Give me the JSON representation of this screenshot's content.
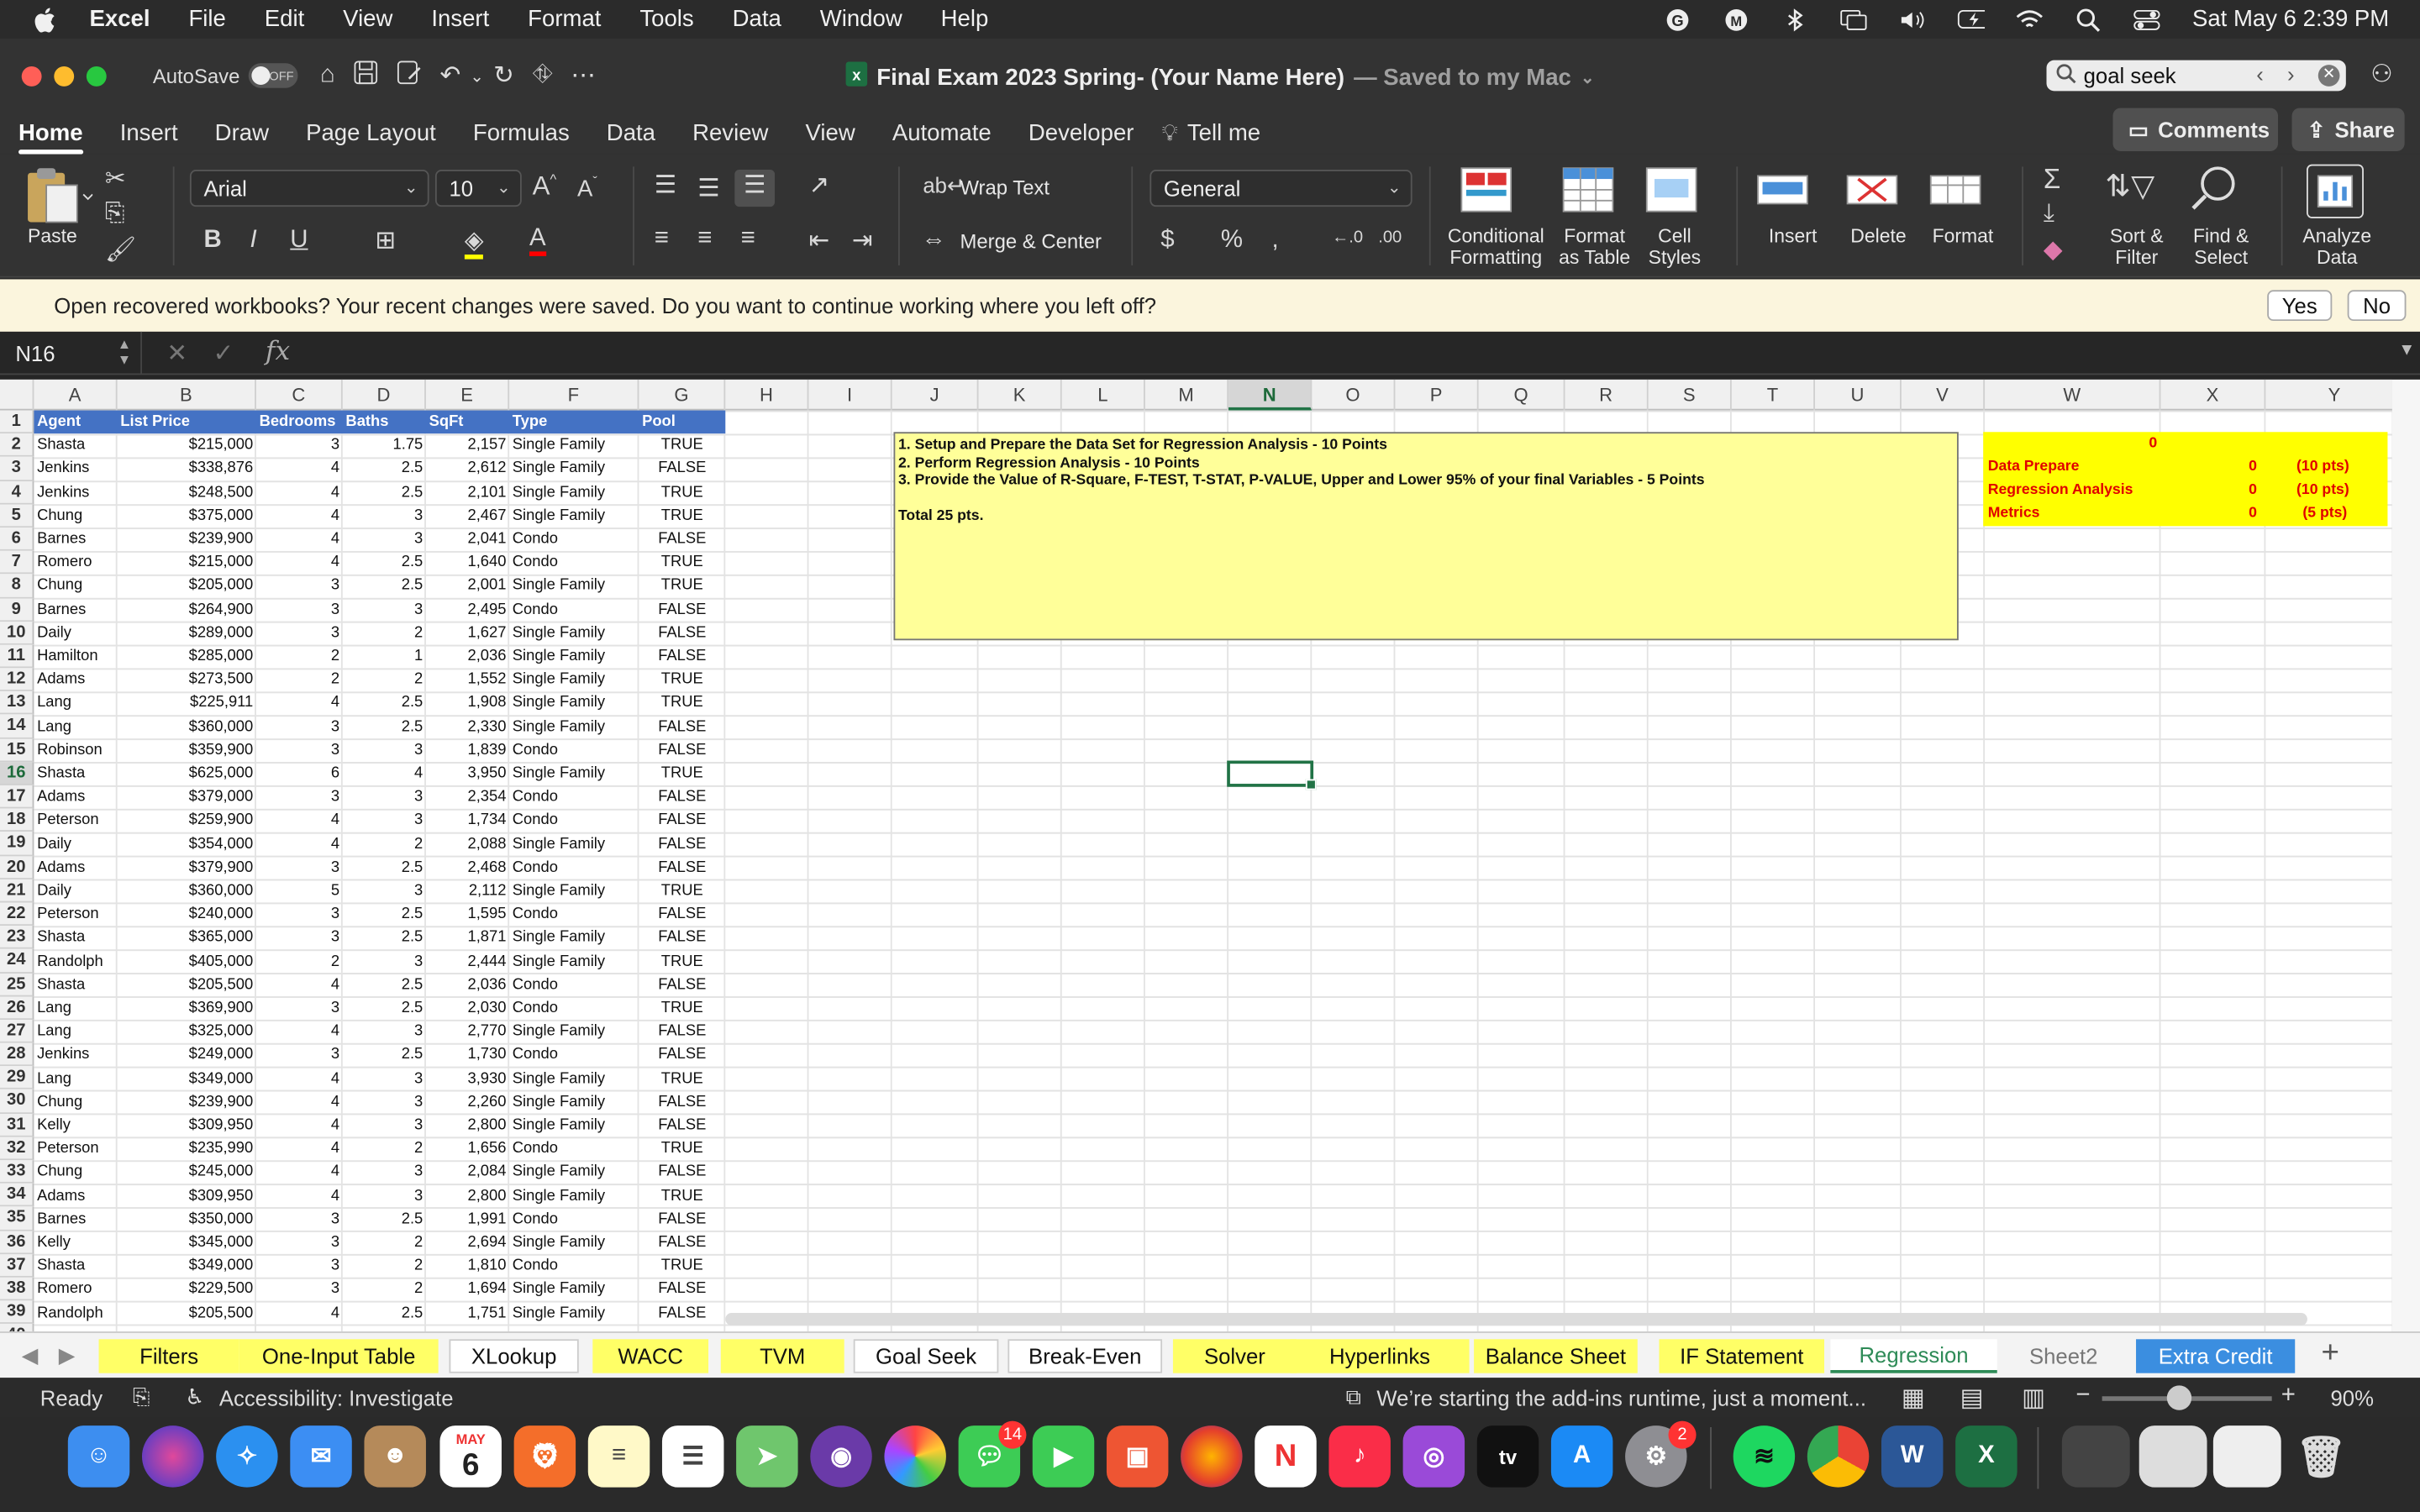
{
  "menubar": {
    "app": "Excel",
    "items": [
      "File",
      "Edit",
      "View",
      "Insert",
      "Format",
      "Tools",
      "Data",
      "Window",
      "Help"
    ],
    "clock": "Sat May 6  2:39 PM"
  },
  "titlebar": {
    "autosave": "AutoSave",
    "autosave_state": "OFF",
    "doc_title": "Final Exam 2023 Spring- (Your Name Here)",
    "saved": "— Saved to my Mac",
    "search": "goal seek"
  },
  "ribbon_tabs": [
    "Home",
    "Insert",
    "Draw",
    "Page Layout",
    "Formulas",
    "Data",
    "Review",
    "View",
    "Automate",
    "Developer",
    "Tell me"
  ],
  "comments": "Comments",
  "share": "Share",
  "ribbon": {
    "paste": "Paste",
    "font": "Arial",
    "size": "10",
    "wrap": "Wrap Text",
    "merge": "Merge & Center",
    "numfmt": "General",
    "cond": "Conditional\nFormatting",
    "fmt_table": "Format\nas Table",
    "cell_styles": "Cell\nStyles",
    "insert": "Insert",
    "delete": "Delete",
    "format": "Format",
    "sort": "Sort &\nFilter",
    "find": "Find &\nSelect",
    "analyze": "Analyze\nData"
  },
  "notification": {
    "text": "Open recovered workbooks?  Your recent changes were saved. Do you want to continue working where you left off?",
    "yes": "Yes",
    "no": "No"
  },
  "namebox": "N16",
  "columns": [
    "A",
    "B",
    "C",
    "D",
    "E",
    "F",
    "G",
    "H",
    "I",
    "J",
    "K",
    "L",
    "M",
    "N",
    "O",
    "P",
    "Q",
    "R",
    "S",
    "T",
    "U",
    "V",
    "W",
    "X",
    "Y"
  ],
  "headers": [
    "Agent",
    "List Price",
    "Bedrooms",
    "Baths",
    "SqFt",
    "Type",
    "Pool"
  ],
  "rows": [
    [
      "Shasta",
      "$215,000",
      "3",
      "1.75",
      "2,157",
      "Single Family",
      "TRUE"
    ],
    [
      "Jenkins",
      "$338,876",
      "4",
      "2.5",
      "2,612",
      "Single Family",
      "FALSE"
    ],
    [
      "Jenkins",
      "$248,500",
      "4",
      "2.5",
      "2,101",
      "Single Family",
      "TRUE"
    ],
    [
      "Chung",
      "$375,000",
      "4",
      "3",
      "2,467",
      "Single Family",
      "TRUE"
    ],
    [
      "Barnes",
      "$239,900",
      "4",
      "3",
      "2,041",
      "Condo",
      "FALSE"
    ],
    [
      "Romero",
      "$215,000",
      "4",
      "2.5",
      "1,640",
      "Condo",
      "TRUE"
    ],
    [
      "Chung",
      "$205,000",
      "3",
      "2.5",
      "2,001",
      "Single Family",
      "TRUE"
    ],
    [
      "Barnes",
      "$264,900",
      "3",
      "3",
      "2,495",
      "Condo",
      "FALSE"
    ],
    [
      "Daily",
      "$289,000",
      "3",
      "2",
      "1,627",
      "Single Family",
      "FALSE"
    ],
    [
      "Hamilton",
      "$285,000",
      "2",
      "1",
      "2,036",
      "Single Family",
      "FALSE"
    ],
    [
      "Adams",
      "$273,500",
      "2",
      "2",
      "1,552",
      "Single Family",
      "TRUE"
    ],
    [
      "Lang",
      "$225,911",
      "4",
      "2.5",
      "1,908",
      "Single Family",
      "TRUE"
    ],
    [
      "Lang",
      "$360,000",
      "3",
      "2.5",
      "2,330",
      "Single Family",
      "FALSE"
    ],
    [
      "Robinson",
      "$359,900",
      "3",
      "3",
      "1,839",
      "Condo",
      "FALSE"
    ],
    [
      "Shasta",
      "$625,000",
      "6",
      "4",
      "3,950",
      "Single Family",
      "TRUE"
    ],
    [
      "Adams",
      "$379,000",
      "3",
      "3",
      "2,354",
      "Condo",
      "FALSE"
    ],
    [
      "Peterson",
      "$259,900",
      "4",
      "3",
      "1,734",
      "Condo",
      "FALSE"
    ],
    [
      "Daily",
      "$354,000",
      "4",
      "2",
      "2,088",
      "Single Family",
      "FALSE"
    ],
    [
      "Adams",
      "$379,900",
      "3",
      "2.5",
      "2,468",
      "Condo",
      "FALSE"
    ],
    [
      "Daily",
      "$360,000",
      "5",
      "3",
      "2,112",
      "Single Family",
      "TRUE"
    ],
    [
      "Peterson",
      "$240,000",
      "3",
      "2.5",
      "1,595",
      "Condo",
      "FALSE"
    ],
    [
      "Shasta",
      "$365,000",
      "3",
      "2.5",
      "1,871",
      "Single Family",
      "FALSE"
    ],
    [
      "Randolph",
      "$405,000",
      "2",
      "3",
      "2,444",
      "Single Family",
      "TRUE"
    ],
    [
      "Shasta",
      "$205,500",
      "4",
      "2.5",
      "2,036",
      "Condo",
      "FALSE"
    ],
    [
      "Lang",
      "$369,900",
      "3",
      "2.5",
      "2,030",
      "Condo",
      "TRUE"
    ],
    [
      "Lang",
      "$325,000",
      "4",
      "3",
      "2,770",
      "Single Family",
      "FALSE"
    ],
    [
      "Jenkins",
      "$249,000",
      "3",
      "2.5",
      "1,730",
      "Condo",
      "FALSE"
    ],
    [
      "Lang",
      "$349,000",
      "4",
      "3",
      "3,930",
      "Single Family",
      "TRUE"
    ],
    [
      "Chung",
      "$239,900",
      "4",
      "3",
      "2,260",
      "Single Family",
      "FALSE"
    ],
    [
      "Kelly",
      "$309,950",
      "4",
      "3",
      "2,800",
      "Single Family",
      "FALSE"
    ],
    [
      "Peterson",
      "$235,990",
      "4",
      "2",
      "1,656",
      "Condo",
      "TRUE"
    ],
    [
      "Chung",
      "$245,000",
      "4",
      "3",
      "2,084",
      "Single Family",
      "FALSE"
    ],
    [
      "Adams",
      "$309,950",
      "4",
      "3",
      "2,800",
      "Single Family",
      "TRUE"
    ],
    [
      "Barnes",
      "$350,000",
      "3",
      "2.5",
      "1,991",
      "Condo",
      "FALSE"
    ],
    [
      "Kelly",
      "$345,000",
      "3",
      "2",
      "2,694",
      "Single Family",
      "FALSE"
    ],
    [
      "Shasta",
      "$349,000",
      "3",
      "2",
      "1,810",
      "Condo",
      "TRUE"
    ],
    [
      "Romero",
      "$229,500",
      "3",
      "2",
      "1,694",
      "Single Family",
      "FALSE"
    ],
    [
      "Randolph",
      "$205,500",
      "4",
      "2.5",
      "1,751",
      "Single Family",
      "FALSE"
    ]
  ],
  "instructions": {
    "l1": "1. Setup and Prepare the Data Set for Regression Analysis - 10 Points",
    "l2": "2.  Perform Regression Analysis - 10 Points",
    "l3": "3.  Provide the Value of R-Square, F-TEST, T-STAT, P-VALUE, Upper and Lower 95% of your final Variables - 5 Points",
    "total": "Total 25 pts."
  },
  "scoring": {
    "total": "0",
    "rows": [
      [
        "Data Prepare",
        "0",
        "(10 pts)"
      ],
      [
        "Regression Analysis",
        "0",
        "(10 pts)"
      ],
      [
        "Metrics",
        "0",
        "(5 pts)"
      ]
    ]
  },
  "sheet_tabs": [
    "Filters",
    "One-Input Table",
    "XLookup",
    "WACC",
    "TVM",
    "Goal Seek",
    "Break-Even",
    "Solver",
    "Hyperlinks",
    "Balance Sheet",
    "IF Statement",
    "Regression",
    "Sheet2",
    "Extra Credit"
  ],
  "status": {
    "ready": "Ready",
    "accessibility": "Accessibility: Investigate",
    "addins": "We’re starting the add-ins runtime, just a moment...",
    "zoom": "90%"
  },
  "dock": {
    "calendar_month": "MAY",
    "calendar_day": "6",
    "messages_badge": "14",
    "settings_badge": "2"
  }
}
